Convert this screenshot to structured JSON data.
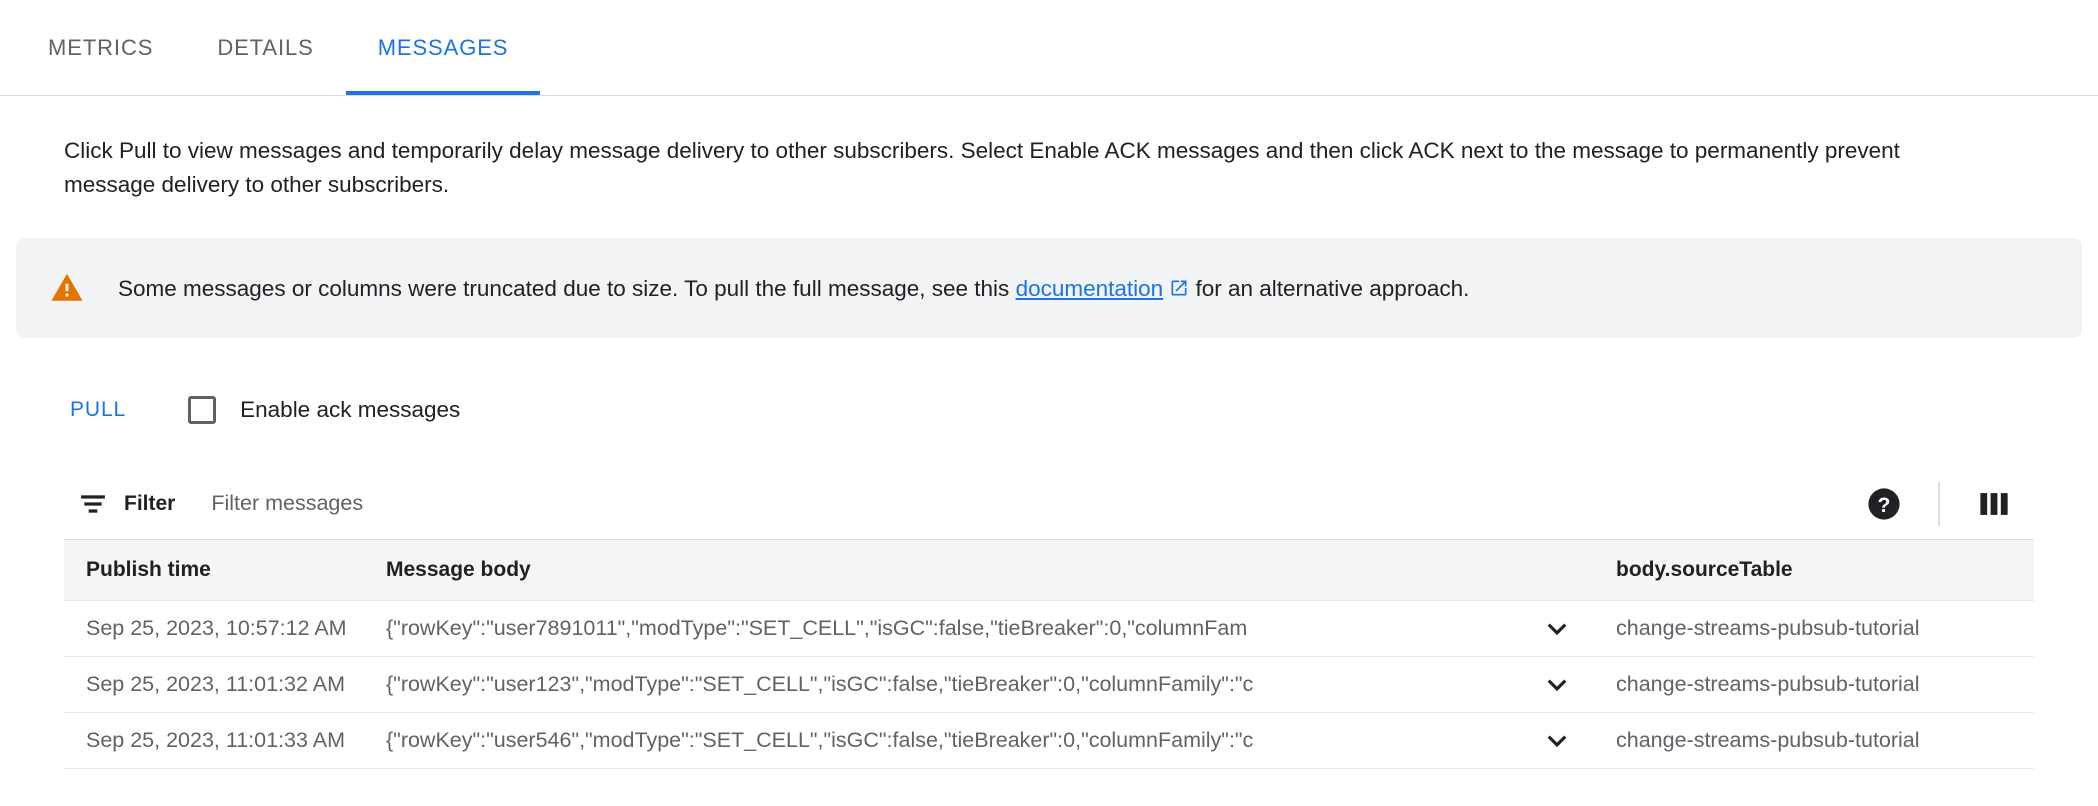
{
  "tabs": [
    {
      "label": "METRICS",
      "active": false
    },
    {
      "label": "DETAILS",
      "active": false
    },
    {
      "label": "MESSAGES",
      "active": true
    }
  ],
  "intro": {
    "text": "Click Pull to view messages and temporarily delay message delivery to other subscribers. Select Enable ACK messages and then click ACK next to the message to permanently prevent message delivery to other subscribers."
  },
  "banner": {
    "icon": "warning-triangle-icon",
    "text_before": "Some messages or columns were truncated due to size. To pull the full message, see this",
    "link_label": "documentation",
    "link_icon": "external-link-icon",
    "text_after": "for an alternative approach.",
    "background_color": "#f1f3f4",
    "icon_color": "#e37400"
  },
  "actions": {
    "pull_label": "PULL",
    "pull_color": "#1a73e8",
    "ack_checkbox_label": "Enable ack messages",
    "ack_checked": false
  },
  "filter_bar": {
    "filter_icon": "filter-list-icon",
    "filter_label": "Filter",
    "filter_placeholder": "Filter messages",
    "filter_value": "",
    "help_icon": "help-circle-icon",
    "columns_icon": "column-display-icon"
  },
  "table": {
    "columns": [
      "Publish time",
      "Message body",
      "",
      "body.sourceTable"
    ],
    "rows": [
      {
        "publish_time": "Sep 25, 2023, 10:57:12 AM",
        "message_body": "{\"rowKey\":\"user7891011\",\"modType\":\"SET_CELL\",\"isGC\":false,\"tieBreaker\":0,\"columnFam",
        "expand_icon": "chevron-down-icon",
        "source_table": "change-streams-pubsub-tutorial"
      },
      {
        "publish_time": "Sep 25, 2023, 11:01:32 AM",
        "message_body": "{\"rowKey\":\"user123\",\"modType\":\"SET_CELL\",\"isGC\":false,\"tieBreaker\":0,\"columnFamily\":\"c",
        "expand_icon": "chevron-down-icon",
        "source_table": "change-streams-pubsub-tutorial"
      },
      {
        "publish_time": "Sep 25, 2023, 11:01:33 AM",
        "message_body": "{\"rowKey\":\"user546\",\"modType\":\"SET_CELL\",\"isGC\":false,\"tieBreaker\":0,\"columnFamily\":\"c",
        "expand_icon": "chevron-down-icon",
        "source_table": "change-streams-pubsub-tutorial"
      }
    ]
  }
}
